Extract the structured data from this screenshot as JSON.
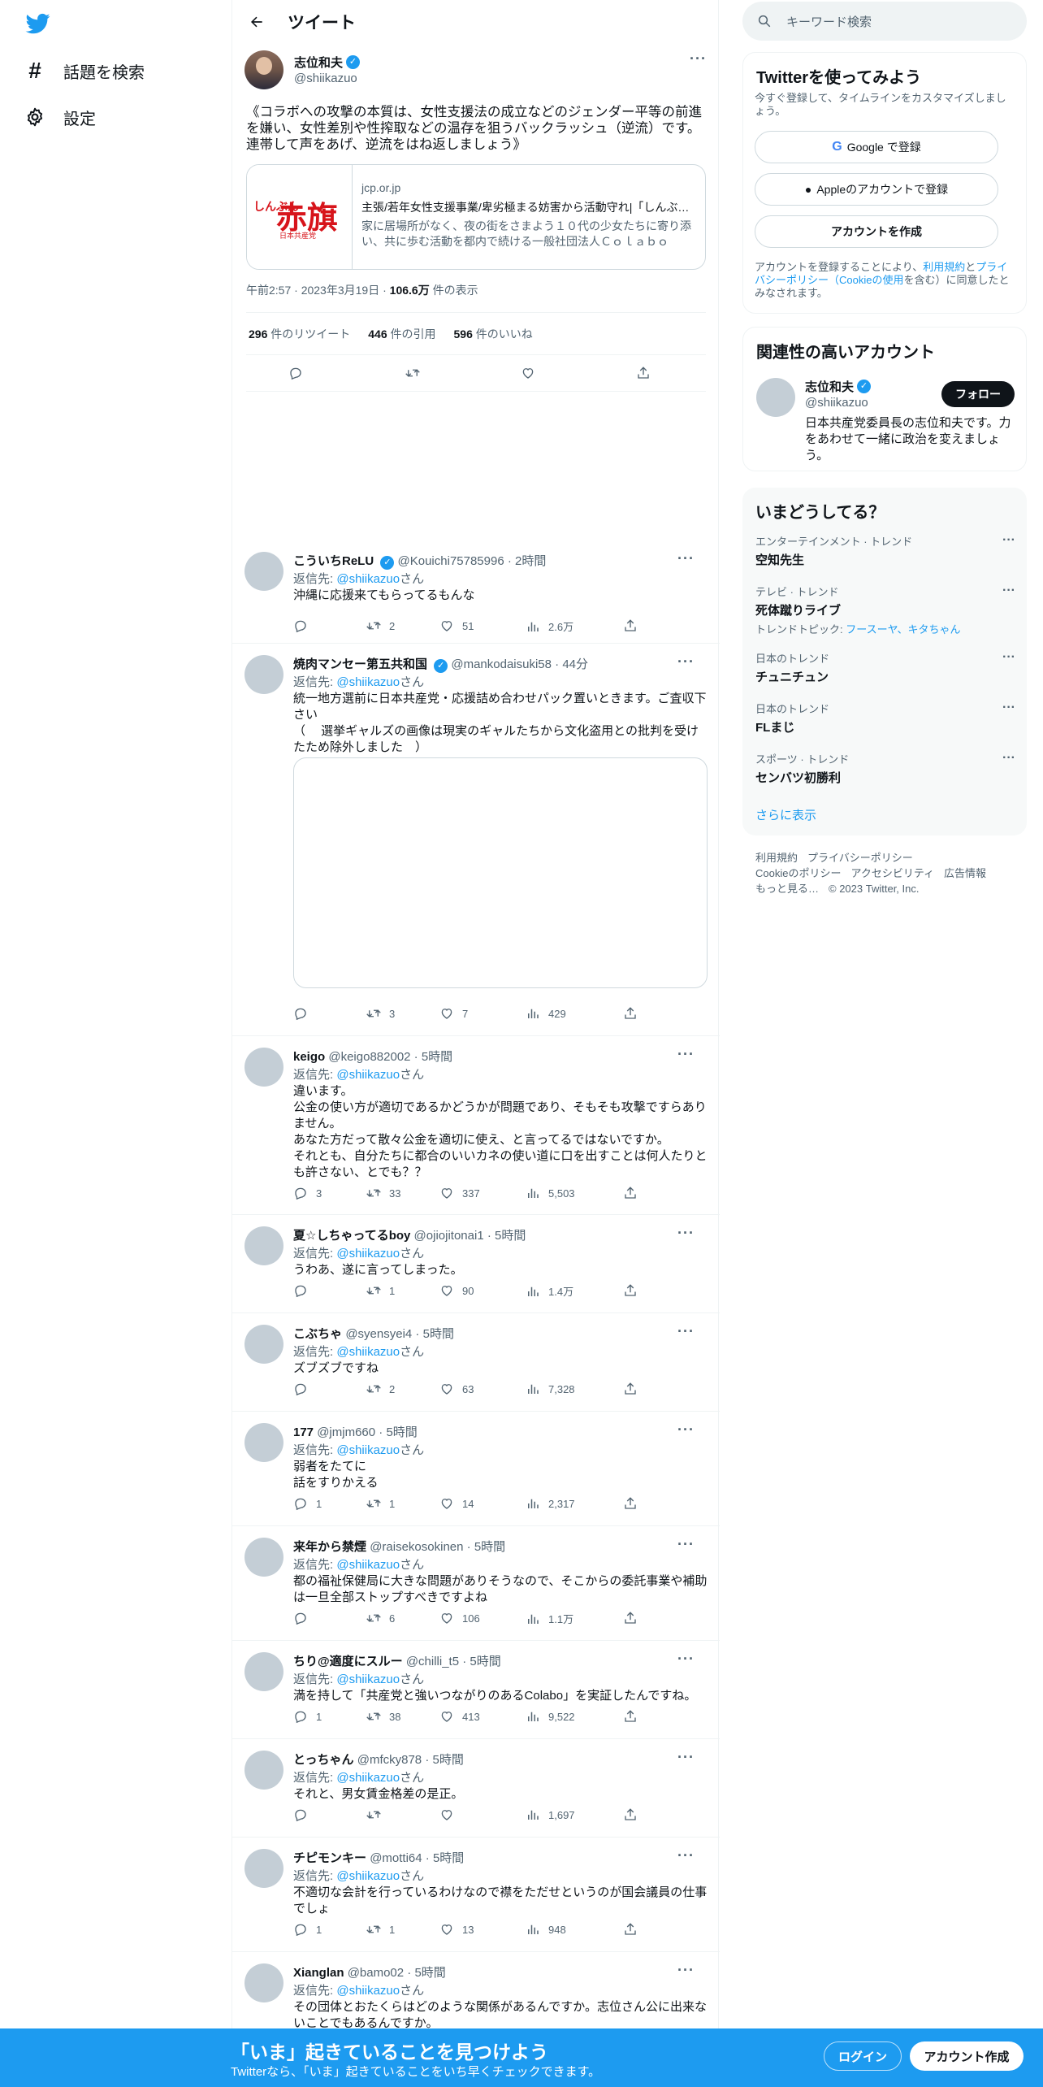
{
  "nav": {
    "explore_label": "話題を検索",
    "settings_label": "設定"
  },
  "header": {
    "title": "ツイート"
  },
  "main_tweet": {
    "author_name": "志位和夫",
    "author_handle": "@shiikazuo",
    "text": "《コラボへの攻撃の本質は、女性支援法の成立などのジェンダー平等の前進を嫌い、女性差別や性搾取などの温存を狙うバックラッシュ（逆流）です。連帯して声をあげ、逆流をはね返しましょう》",
    "card": {
      "thumb_small": "しんぶん",
      "thumb_big": "赤旗",
      "thumb_sub": "日本共産党",
      "domain": "jcp.or.jp",
      "title": "主張/若年女性支援事業/卑劣極まる妨害から活動守れ|「しんぶん赤旗」",
      "description": "家に居場所がなく、夜の街をさまよう１０代の少女たちに寄り添い、共に歩む活動を都内で続ける一般社団法人Ｃｏｌａｂｏ"
    },
    "time": "午前2:57",
    "date": "2023年3月19日",
    "views_count": "106.6万",
    "views_label": "件の表示",
    "retweets_count": "296",
    "retweets_label": "件のリツイート",
    "quotes_count": "446",
    "quotes_label": "件の引用",
    "likes_count": "596",
    "likes_label": "件のいいね"
  },
  "reply_prefix": "返信先: ",
  "reply_suffix": "さん",
  "replies": [
    {
      "name": "こういちReLU",
      "handle": "@Kouichi75785996",
      "time": "2時間",
      "to": "@shiikazuo",
      "text": "沖縄に応援来てもらってるもんな",
      "replies": "",
      "retweets": "2",
      "likes": "51",
      "views": "2.6万"
    },
    {
      "name": "焼肉マンセー第五共和国",
      "handle": "@mankodaisuki58",
      "time": "44分",
      "to": "@shiikazuo",
      "text": "統一地方選前に日本共産党・応援詰め合わせパック置いときます。ご査収下さい\n（　 選挙ギャルズの画像は現実のギャルたちから文化盗用との批判を受けたため除外しました　）",
      "replies": "",
      "retweets": "3",
      "likes": "7",
      "views": "429"
    },
    {
      "name": "keigo",
      "handle": "@keigo882002",
      "time": "5時間",
      "to": "@shiikazuo",
      "text": "違います。\n公金の使い方が適切であるかどうかが問題であり、そもそも攻撃ですらありません。\nあなた方だって散々公金を適切に使え、と言ってるではないですか。\nそれとも、自分たちに都合のいいカネの使い道に口を出すことは何人たりとも許さない、とでも？？",
      "replies": "3",
      "retweets": "33",
      "likes": "337",
      "views": "5,503"
    },
    {
      "name": "夏☆しちゃってるboy",
      "handle": "@ojiojitonai1",
      "time": "5時間",
      "to": "@shiikazuo",
      "text": "うわあ、遂に言ってしまった。",
      "replies": "",
      "retweets": "1",
      "likes": "90",
      "views": "1.4万"
    },
    {
      "name": "こぶちゃ",
      "handle": "@syensyei4",
      "time": "5時間",
      "to": "@shiikazuo",
      "text": "ズブズブですね",
      "replies": "",
      "retweets": "2",
      "likes": "63",
      "views": "7,328"
    },
    {
      "name": "177",
      "handle": "@jmjm660",
      "time": "5時間",
      "to": "@shiikazuo",
      "text": "弱者をたてに\n話をすりかえる",
      "replies": "1",
      "retweets": "1",
      "likes": "14",
      "views": "2,317"
    },
    {
      "name": "来年から禁煙",
      "handle": "@raisekosokinen",
      "time": "5時間",
      "to": "@shiikazuo",
      "text": "都の福祉保健局に大きな問題がありそうなので、そこからの委託事業や補助は一旦全部ストップすべきですよね",
      "replies": "",
      "retweets": "6",
      "likes": "106",
      "views": "1.1万"
    },
    {
      "name": "ちり@適度にスルー",
      "handle": "@chilli_t5",
      "time": "5時間",
      "to": "@shiikazuo",
      "text": "満を持して「共産党と強いつながりのあるColabo」を実証したんですね。",
      "replies": "1",
      "retweets": "38",
      "likes": "413",
      "views": "9,522"
    },
    {
      "name": "とっちゃん",
      "handle": "@mfcky878",
      "time": "5時間",
      "to": "@shiikazuo",
      "text": "それと、男女賃金格差の是正。",
      "replies": "",
      "retweets": "",
      "likes": "",
      "views": "1,697"
    },
    {
      "name": "チピモンキー",
      "handle": "@motti64",
      "time": "5時間",
      "to": "@shiikazuo",
      "text": "不適切な会計を行っているわけなので襟をただせというのが国会議員の仕事でしょ",
      "replies": "1",
      "retweets": "1",
      "likes": "13",
      "views": "948"
    },
    {
      "name": "Xianglan",
      "handle": "@bamo02",
      "time": "5時間",
      "to": "@shiikazuo",
      "text": "その団体とおたくらはどのような関係があるんですか。志位さん公に出来ないことでもあるんですか。",
      "replies": "",
      "retweets": "",
      "likes": "",
      "views": ""
    }
  ],
  "search": {
    "placeholder": "キーワード検索"
  },
  "signup_panel": {
    "title": "Twitterを使ってみよう",
    "subtitle": "今すぐ登録して、タイムラインをカスタマイズしましょう。",
    "google": "Google で登録",
    "apple": "Appleのアカウントで登録",
    "create": "アカウントを作成",
    "legal_1": "アカウントを登録することにより、",
    "legal_terms": "利用規約",
    "legal_and": "と",
    "legal_privacy": "プライバシーポリシー",
    "legal_cookie": "（Cookieの使用",
    "legal_2": "を含む）に同意したとみなされます。"
  },
  "related_panel": {
    "title": "関連性の高いアカウント",
    "name": "志位和夫",
    "handle": "@shiikazuo",
    "follow": "フォロー",
    "bio": "日本共産党委員長の志位和夫です。力をあわせて一緒に政治を変えましょう。"
  },
  "trends_panel": {
    "title": "いまどうしてる？",
    "items": [
      {
        "category": "エンターテインメント · トレンド",
        "name": "空知先生",
        "topic_label": "",
        "topics": ""
      },
      {
        "category": "テレビ · トレンド",
        "name": "死体蹴りライブ",
        "topic_label": "トレンドトピック: ",
        "topics": "フースーヤ、キタちゃん"
      },
      {
        "category": "日本のトレンド",
        "name": "チュニチュン",
        "topic_label": "",
        "topics": ""
      },
      {
        "category": "日本のトレンド",
        "name": "FLまじ",
        "topic_label": "",
        "topics": ""
      },
      {
        "category": "スポーツ · トレンド",
        "name": "センバツ初勝利",
        "topic_label": "",
        "topics": ""
      }
    ],
    "show_more": "さらに表示"
  },
  "footer": {
    "terms": "利用規約",
    "privacy": "プライバシーポリシー",
    "cookie": "Cookieのポリシー",
    "accessibility": "アクセシビリティ",
    "ads": "広告情報",
    "more": "もっと見る…",
    "copyright": "© 2023 Twitter, Inc."
  },
  "banner": {
    "headline": "「いま」起きていることを見つけよう",
    "sub": "Twitterなら、「いま」起きていることをいち早くチェックできます。",
    "login": "ログイン",
    "signup": "アカウント作成"
  },
  "colors": {
    "accent": "#1d9bf0",
    "text": "#0f1419",
    "muted": "#536471",
    "border": "#eff3f4"
  }
}
